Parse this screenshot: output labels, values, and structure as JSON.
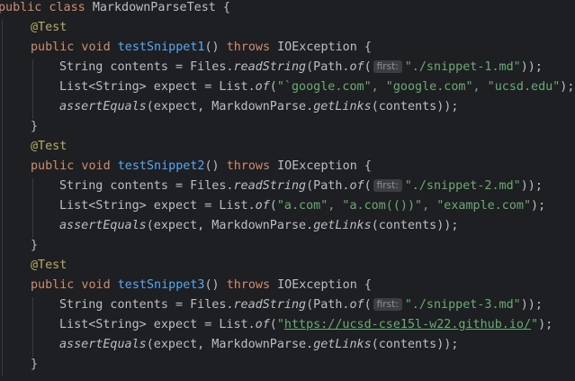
{
  "colors": {
    "background": "#1e1f22",
    "text": "#bcbec4",
    "keyword": "#cf8e6d",
    "method": "#56a8f5",
    "annotation": "#b3ae60",
    "string": "#6aab73",
    "hint_bg": "#3b3d41",
    "hint_text": "#8c8f94"
  },
  "code": {
    "class_decl": {
      "kw": "public class ",
      "name": "MarkdownParseTest",
      "rest": " {"
    },
    "tests": [
      {
        "annotation": "@Test",
        "sig_kw": "public void ",
        "sig_name": "testSnippet1",
        "sig_mid": "() ",
        "sig_throws": "throws",
        "sig_rest": " IOException {",
        "l1_a": "String contents = Files.",
        "l1_b": "readString",
        "l1_c": "(Path.",
        "l1_d": "of",
        "l1_e": "(",
        "hint": "first:",
        "l1_str": "\"./snippet-1.md\"",
        "l1_end": "));",
        "l2_a": "List<String> expect = List.",
        "l2_b": "of",
        "l2_c": "(",
        "l2_str": "\"`google.com\", \"google.com\", \"ucsd.edu\"",
        "l2_end": ");",
        "l3_a": "assertEquals",
        "l3_b": "(expect, MarkdownParse.",
        "l3_c": "getLinks",
        "l3_d": "(contents));",
        "close": "}"
      },
      {
        "annotation": "@Test",
        "sig_kw": "public void ",
        "sig_name": "testSnippet2",
        "sig_mid": "() ",
        "sig_throws": "throws",
        "sig_rest": " IOException {",
        "l1_a": "String contents = Files.",
        "l1_b": "readString",
        "l1_c": "(Path.",
        "l1_d": "of",
        "l1_e": "(",
        "hint": "first:",
        "l1_str": "\"./snippet-2.md\"",
        "l1_end": "));",
        "l2_a": "List<String> expect = List.",
        "l2_b": "of",
        "l2_c": "(",
        "l2_str": "\"a.com\", \"a.com(())\", \"example.com\"",
        "l2_end": ");",
        "l3_a": "assertEquals",
        "l3_b": "(expect, MarkdownParse.",
        "l3_c": "getLinks",
        "l3_d": "(contents));",
        "close": "}"
      },
      {
        "annotation": "@Test",
        "sig_kw": "public void ",
        "sig_name": "testSnippet3",
        "sig_mid": "() ",
        "sig_throws": "throws",
        "sig_rest": " IOException {",
        "l1_a": "String contents = Files.",
        "l1_b": "readString",
        "l1_c": "(Path.",
        "l1_d": "of",
        "l1_e": "(",
        "hint": "first:",
        "l1_str": "\"./snippet-3.md\"",
        "l1_end": "));",
        "l2_a": "List<String> expect = List.",
        "l2_b": "of",
        "l2_c": "(",
        "l2_q1": "\"",
        "l2_url": "https://ucsd-cse15l-w22.github.io/",
        "l2_q2": "\"",
        "l2_end": ");",
        "l3_a": "assertEquals",
        "l3_b": "(expect, MarkdownParse.",
        "l3_c": "getLinks",
        "l3_d": "(contents));",
        "close": "}"
      }
    ]
  }
}
